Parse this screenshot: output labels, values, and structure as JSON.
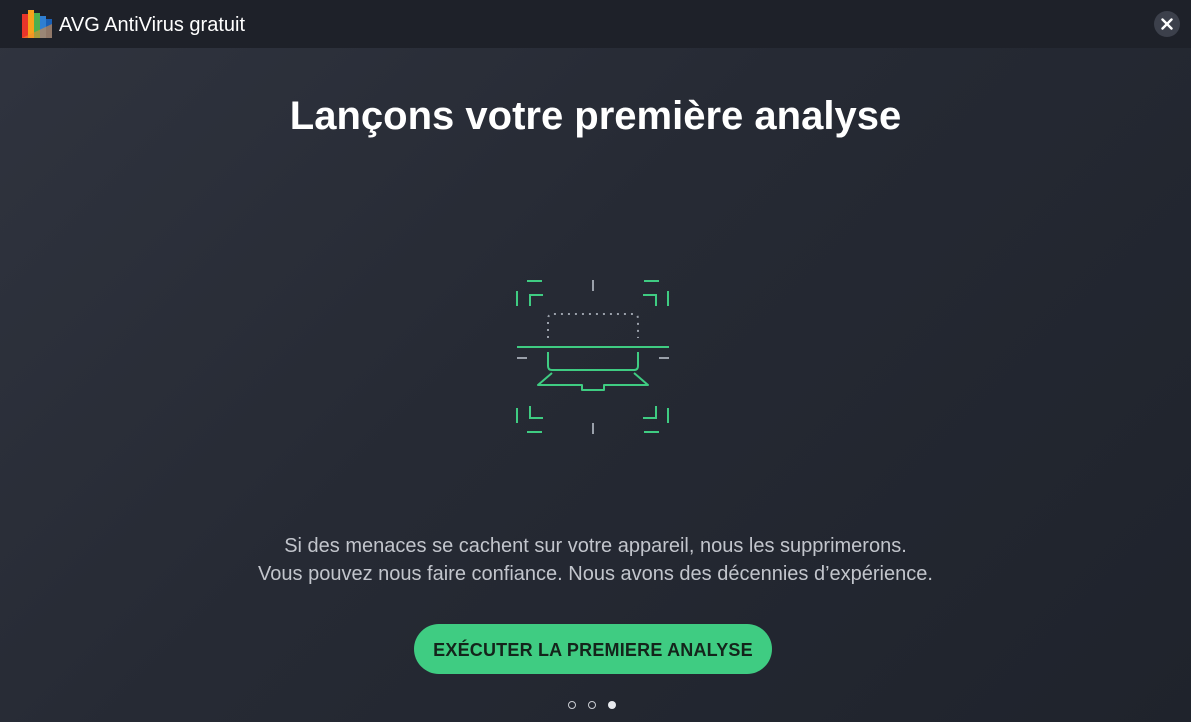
{
  "window": {
    "title": "AVG AntiVirus gratuit",
    "close_label": "×"
  },
  "main": {
    "headline": "Lançons votre première analyse",
    "description_line1": "Si des menaces se cachent sur votre appareil, nous les supprimerons.",
    "description_line2": "Vous pouvez nous faire confiance. Nous avons des décennies d’expérience.",
    "cta_label": "EXÉCUTER LA PREMIERE ANALYSE"
  },
  "pager": {
    "total": 3,
    "active_index": 3
  },
  "colors": {
    "accent_green": "#3fcc82",
    "background": "#2a2e39",
    "titlebar": "#1e2129"
  },
  "icons": {
    "logo": "avg-logo-icon",
    "close": "close-icon",
    "illustration": "laptop-scan-icon"
  }
}
